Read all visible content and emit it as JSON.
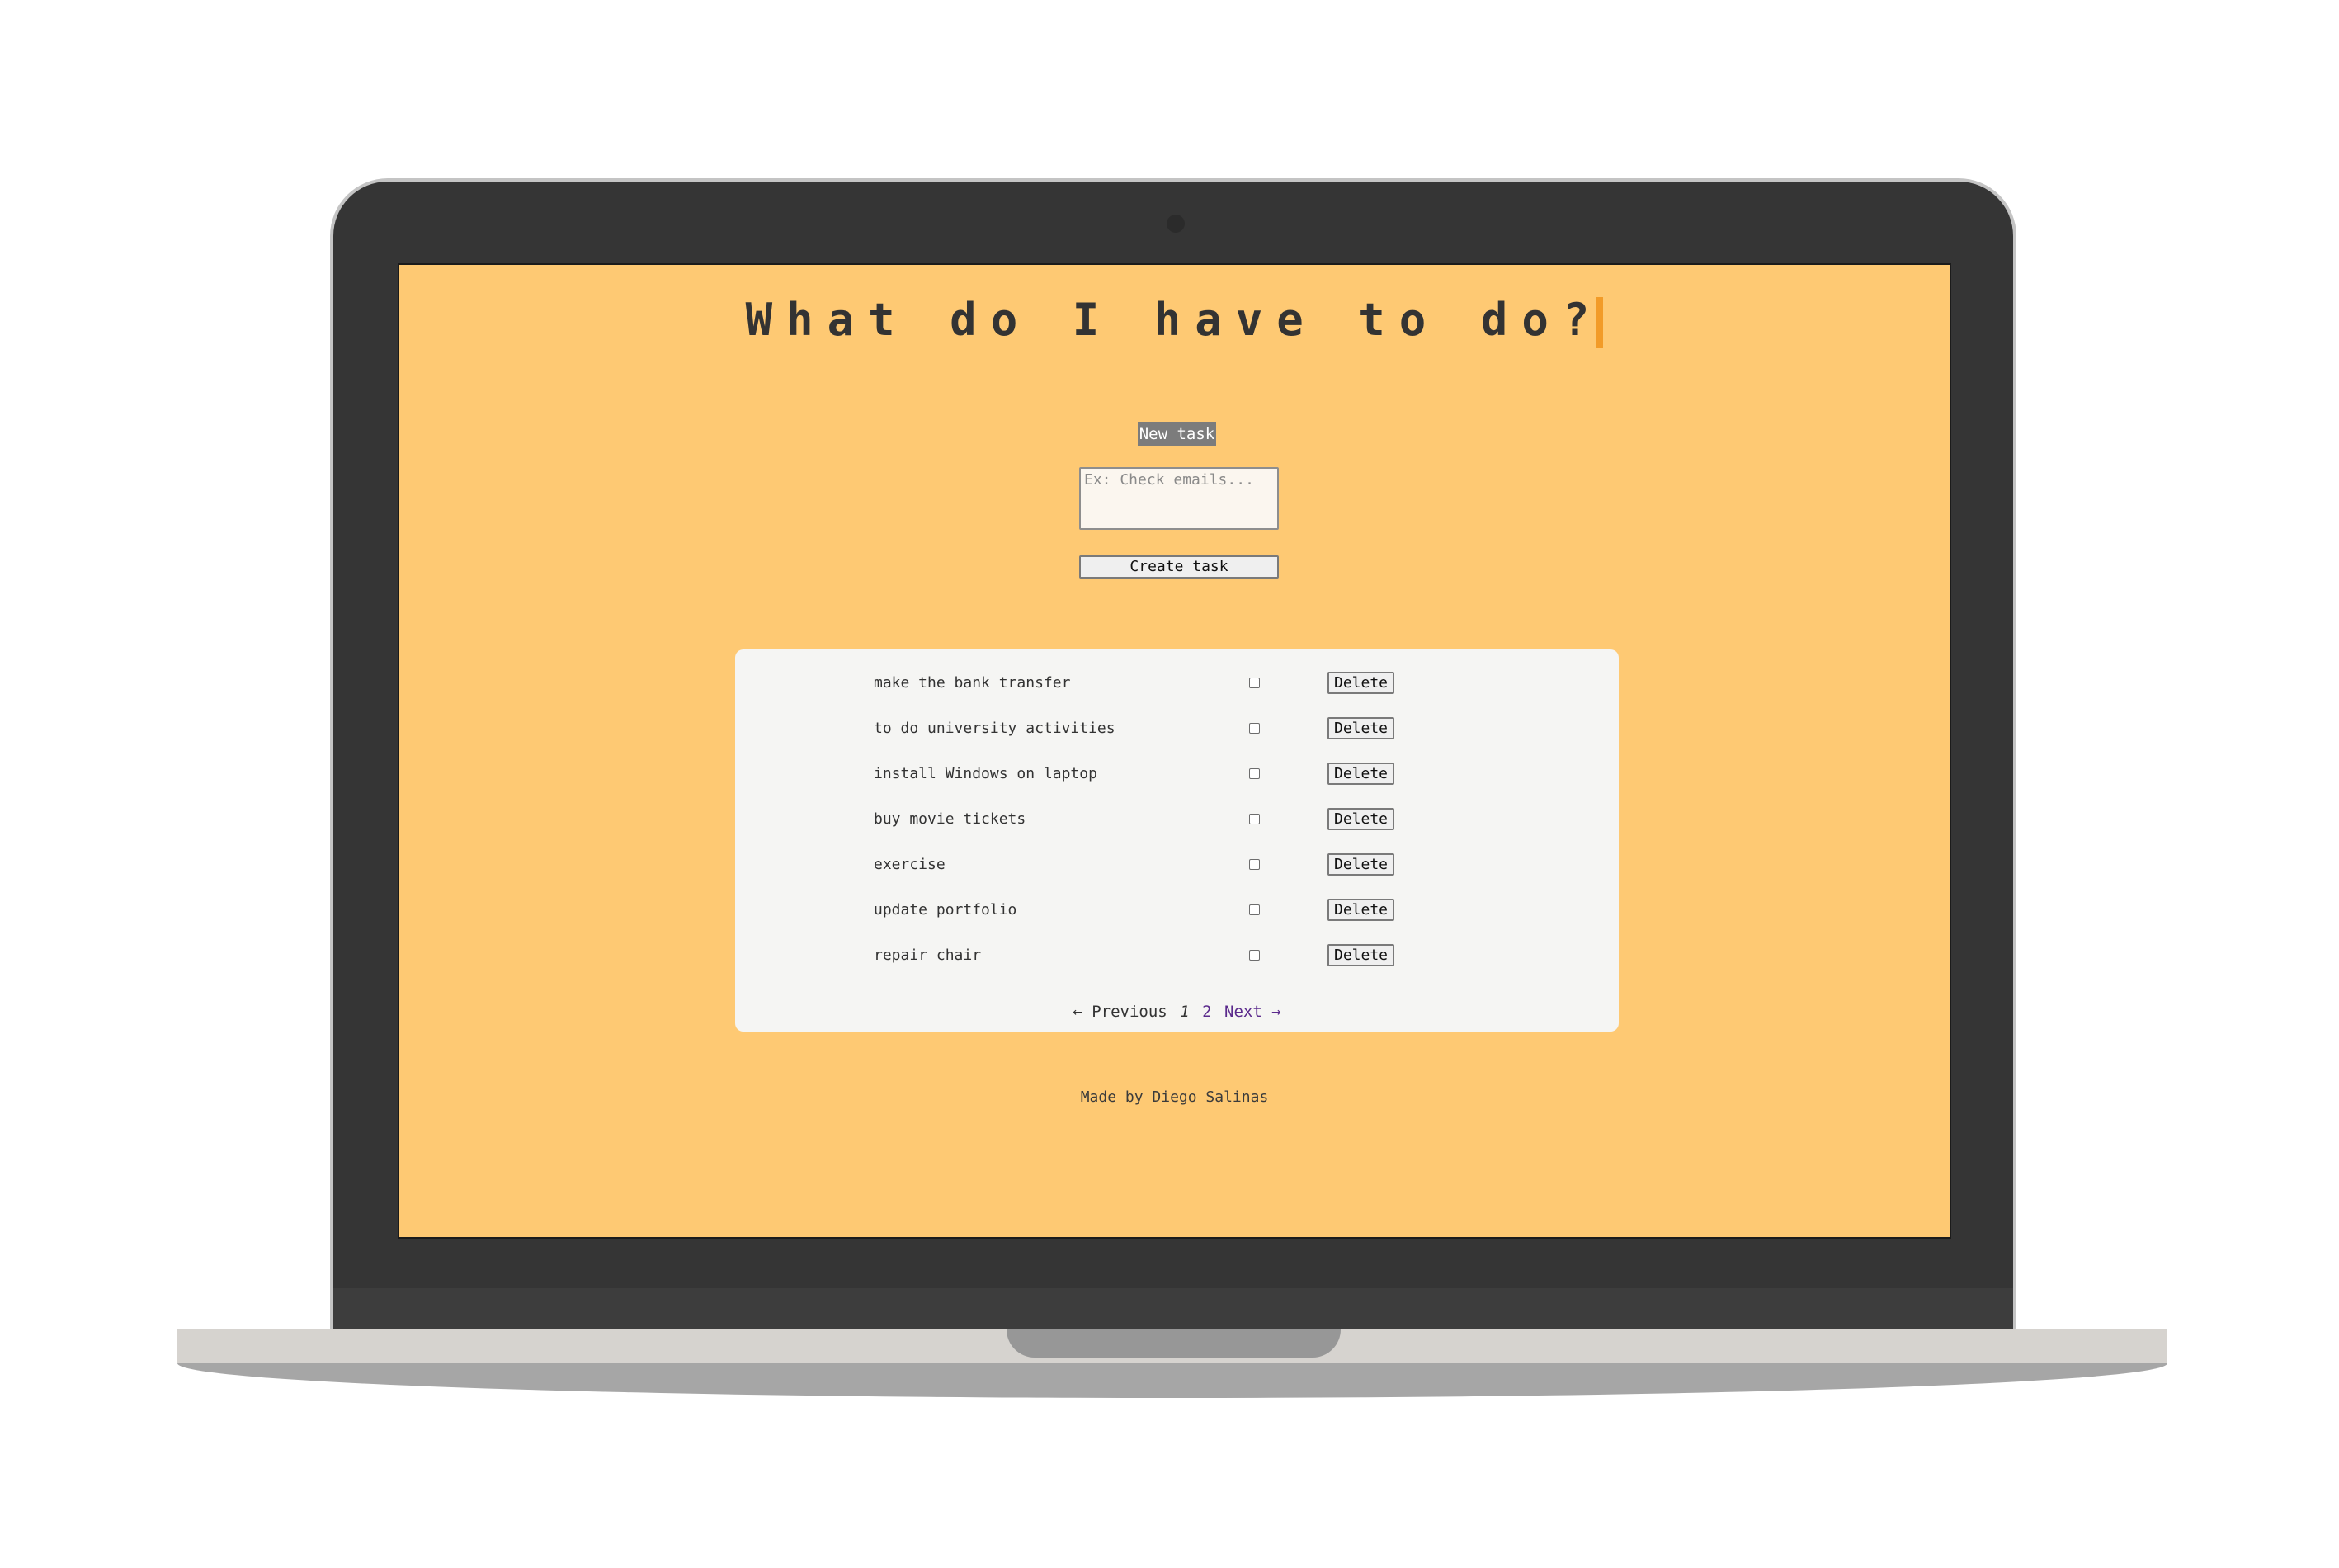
{
  "app": {
    "title": "What do I have to do?"
  },
  "form": {
    "section_label": "New task",
    "input_value": "",
    "input_placeholder": "Ex: Check emails...",
    "submit_label": "Create task"
  },
  "tasks": [
    {
      "label": "make the bank transfer",
      "checked": false,
      "delete_label": "Delete"
    },
    {
      "label": "to do university activities",
      "checked": false,
      "delete_label": "Delete"
    },
    {
      "label": "install Windows on laptop",
      "checked": false,
      "delete_label": "Delete"
    },
    {
      "label": "buy movie tickets",
      "checked": false,
      "delete_label": "Delete"
    },
    {
      "label": "exercise",
      "checked": false,
      "delete_label": "Delete"
    },
    {
      "label": "update portfolio",
      "checked": false,
      "delete_label": "Delete"
    },
    {
      "label": "repair chair",
      "checked": false,
      "delete_label": "Delete"
    }
  ],
  "pagination": {
    "previous": "← Previous",
    "current_page": "1",
    "next_page": "2",
    "next": "Next →"
  },
  "footer": {
    "credit": "Made by Diego Salinas"
  },
  "colors": {
    "screen_background": "#fec973",
    "card_background": "#f5f5f3",
    "title_cursor": "#f29b28",
    "badge_background": "#7c7c7c",
    "link": "#5b2a8c"
  }
}
